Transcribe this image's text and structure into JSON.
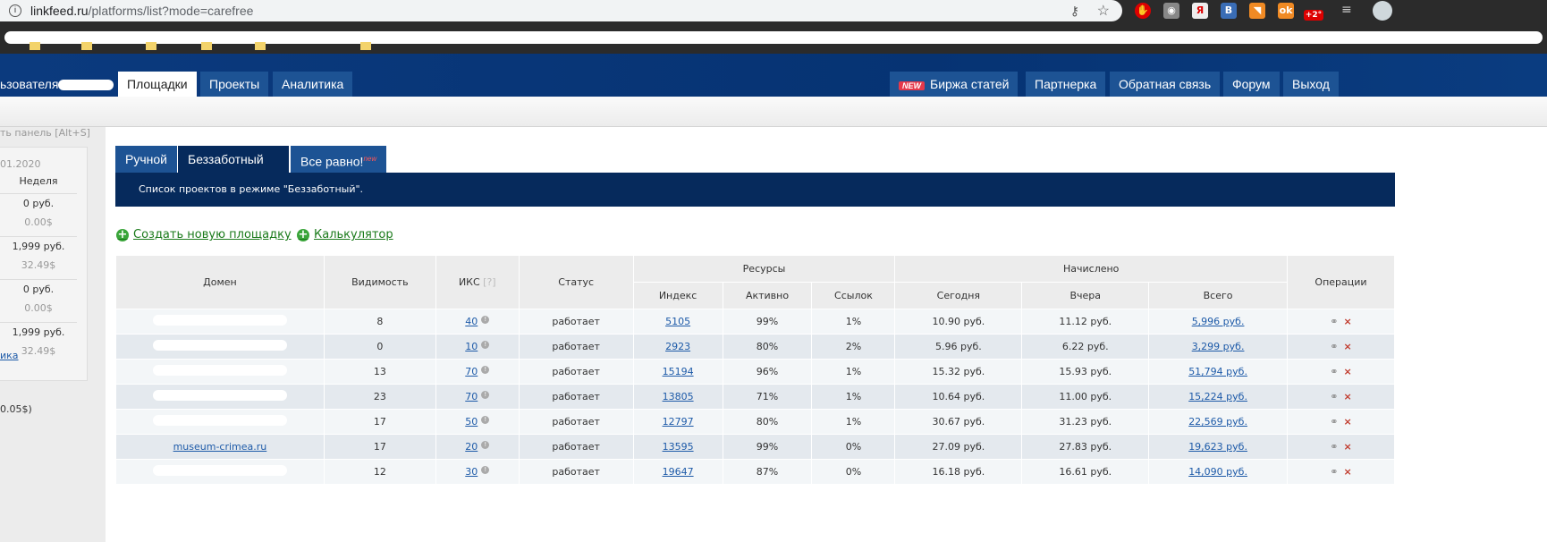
{
  "browser": {
    "url_host": "linkfeed.ru",
    "url_path": "/platforms/list?mode=carefree",
    "weather": "+2°"
  },
  "nav": {
    "user_label": "ьзователя",
    "items": [
      "Площадки",
      "Проекты",
      "Аналитика"
    ],
    "new_badge": "NEW",
    "right_items": [
      "Биржа статей",
      "Партнерка",
      "Обратная связь",
      "Форум",
      "Выход"
    ]
  },
  "sidebar": {
    "hide_panel": "ть панель [Alt+S]",
    "date": "01.2020",
    "period": "Неделя",
    "values": [
      [
        "0 руб.",
        "0.00$"
      ],
      [
        "1,999 руб.",
        "32.49$"
      ],
      [
        "0 руб.",
        "0.00$"
      ],
      [
        "1,999 руб.",
        "32.49$"
      ]
    ],
    "link": "ика",
    "balance": "0.05$)"
  },
  "tabs": {
    "items": [
      "Ручной",
      "Беззаботный",
      "Все равно!"
    ],
    "new_sup": "new"
  },
  "description": "Список проектов в режиме \"Беззаботный\".",
  "actions": {
    "create": "Создать новую площадку",
    "calculator": "Калькулятор"
  },
  "table": {
    "headers": {
      "domain": "Домен",
      "visibility": "Видимость",
      "iks": "ИКС",
      "iks_help": "[?]",
      "status": "Статус",
      "resources": "Ресурсы",
      "accrued": "Начислено",
      "operations": "Операции",
      "index": "Индекс",
      "active": "Активно",
      "links": "Ссылок",
      "today": "Сегодня",
      "yesterday": "Вчера",
      "total": "Всего"
    },
    "rows": [
      {
        "domain": "",
        "visibility": "8",
        "iks": "40",
        "status": "работает",
        "index": "5105",
        "active": "99%",
        "links": "1%",
        "today": "10.90 руб.",
        "yesterday": "11.12 руб.",
        "total": "5,996 руб."
      },
      {
        "domain": "",
        "visibility": "0",
        "iks": "10",
        "status": "работает",
        "index": "2923",
        "active": "80%",
        "links": "2%",
        "today": "5.96 руб.",
        "yesterday": "6.22 руб.",
        "total": "3,299 руб."
      },
      {
        "domain": "",
        "visibility": "13",
        "iks": "70",
        "status": "работает",
        "index": "15194",
        "active": "96%",
        "links": "1%",
        "today": "15.32 руб.",
        "yesterday": "15.93 руб.",
        "total": "51,794 руб."
      },
      {
        "domain": "",
        "visibility": "23",
        "iks": "70",
        "status": "работает",
        "index": "13805",
        "active": "71%",
        "links": "1%",
        "today": "10.64 руб.",
        "yesterday": "11.00 руб.",
        "total": "15,224 руб."
      },
      {
        "domain": "",
        "visibility": "17",
        "iks": "50",
        "status": "работает",
        "index": "12797",
        "active": "80%",
        "links": "1%",
        "today": "30.67 руб.",
        "yesterday": "31.23 руб.",
        "total": "22,569 руб."
      },
      {
        "domain": "museum-crimea.ru",
        "visibility": "17",
        "iks": "20",
        "status": "работает",
        "index": "13595",
        "active": "99%",
        "links": "0%",
        "today": "27.09 руб.",
        "yesterday": "27.83 руб.",
        "total": "19,623 руб."
      },
      {
        "domain": "",
        "visibility": "12",
        "iks": "30",
        "status": "работает",
        "index": "19647",
        "active": "87%",
        "links": "0%",
        "today": "16.18 руб.",
        "yesterday": "16.61 руб.",
        "total": "14,090 руб."
      }
    ]
  }
}
